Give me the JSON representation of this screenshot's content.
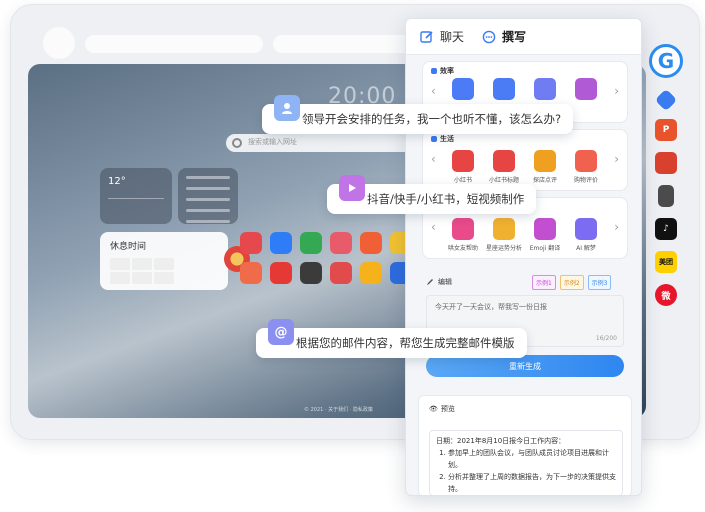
{
  "desktop": {
    "clock": "20:00",
    "search_placeholder": "搜索或输入网址",
    "weather_temp": "12°",
    "time_widget_title": "休息时间",
    "footer": "© 2021 · 关于我们 · 隐私政策"
  },
  "panel": {
    "tabs": [
      {
        "label": "聊天",
        "icon": "edit-icon"
      },
      {
        "label": "撰写",
        "icon": "chat-icon"
      }
    ],
    "sections": [
      {
        "title": "效率",
        "tools": [
          {
            "label": "",
            "icon": "list-icon",
            "color": "#4b7bf5"
          },
          {
            "label": "",
            "icon": "doc-icon",
            "color": "#4b7bf5"
          },
          {
            "label": "",
            "icon": "email-icon",
            "color": "#6f7cf2"
          },
          {
            "label": "",
            "icon": "video-icon",
            "color": "#b05ad6"
          }
        ]
      },
      {
        "title": "生活",
        "tools": [
          {
            "label": "小红书",
            "icon": "xiaohongshu-icon",
            "color": "#e64543"
          },
          {
            "label": "小红书标题",
            "icon": "title-icon",
            "color": "#e64543"
          },
          {
            "label": "探店点评",
            "icon": "shop-icon",
            "color": "#f0a020"
          },
          {
            "label": "购物评价",
            "icon": "cart-icon",
            "color": "#f0614f"
          }
        ]
      },
      {
        "title": "",
        "tools": [
          {
            "label": "哄女友帮助",
            "icon": "heart-icon",
            "color": "#e84a8a"
          },
          {
            "label": "星座运势分析",
            "icon": "star-icon",
            "color": "#f0b030"
          },
          {
            "label": "Emoji 翻译",
            "icon": "emoji-icon",
            "color": "#c14fd0"
          },
          {
            "label": "AI 解梦",
            "icon": "moon-icon",
            "color": "#7c6cf2"
          }
        ]
      }
    ],
    "edit": {
      "label": "编辑",
      "examples": [
        "示例1",
        "示例2",
        "示例3"
      ],
      "input_value": "今天开了一天会议，帮我写一份日报",
      "counter": "16/200",
      "generate_label": "重新生成"
    },
    "preview": {
      "label": "预览",
      "date_line": "日期：2021年8月10日报今日工作内容：",
      "items": [
        "参加早上的团队会议，与团队成员讨论项目进展和计划。",
        "分析并整理了上周的数据报告，为下一步的决策提供支持。"
      ]
    }
  },
  "bubbles": [
    {
      "text": "领导开会安排的任务，我一个也听不懂，该怎么办?",
      "icon": "user-icon"
    },
    {
      "text": "抖音/快手/小红书，短视频制作",
      "icon": "video-icon"
    },
    {
      "text": "根据您的邮件内容，帮您生成完整邮件模版",
      "icon": "email-icon"
    }
  ],
  "side_icons": [
    {
      "name": "browser-logo-icon",
      "label": "G"
    },
    {
      "name": "tag-icon",
      "label": ""
    },
    {
      "name": "powerpoint-icon",
      "label": "P"
    },
    {
      "name": "toolbox-icon",
      "label": ""
    },
    {
      "name": "chess-icon",
      "label": ""
    },
    {
      "name": "tiktok-icon",
      "label": "♪"
    },
    {
      "name": "meituan-icon",
      "label": "美团"
    },
    {
      "name": "weibo-icon",
      "label": "微"
    }
  ]
}
